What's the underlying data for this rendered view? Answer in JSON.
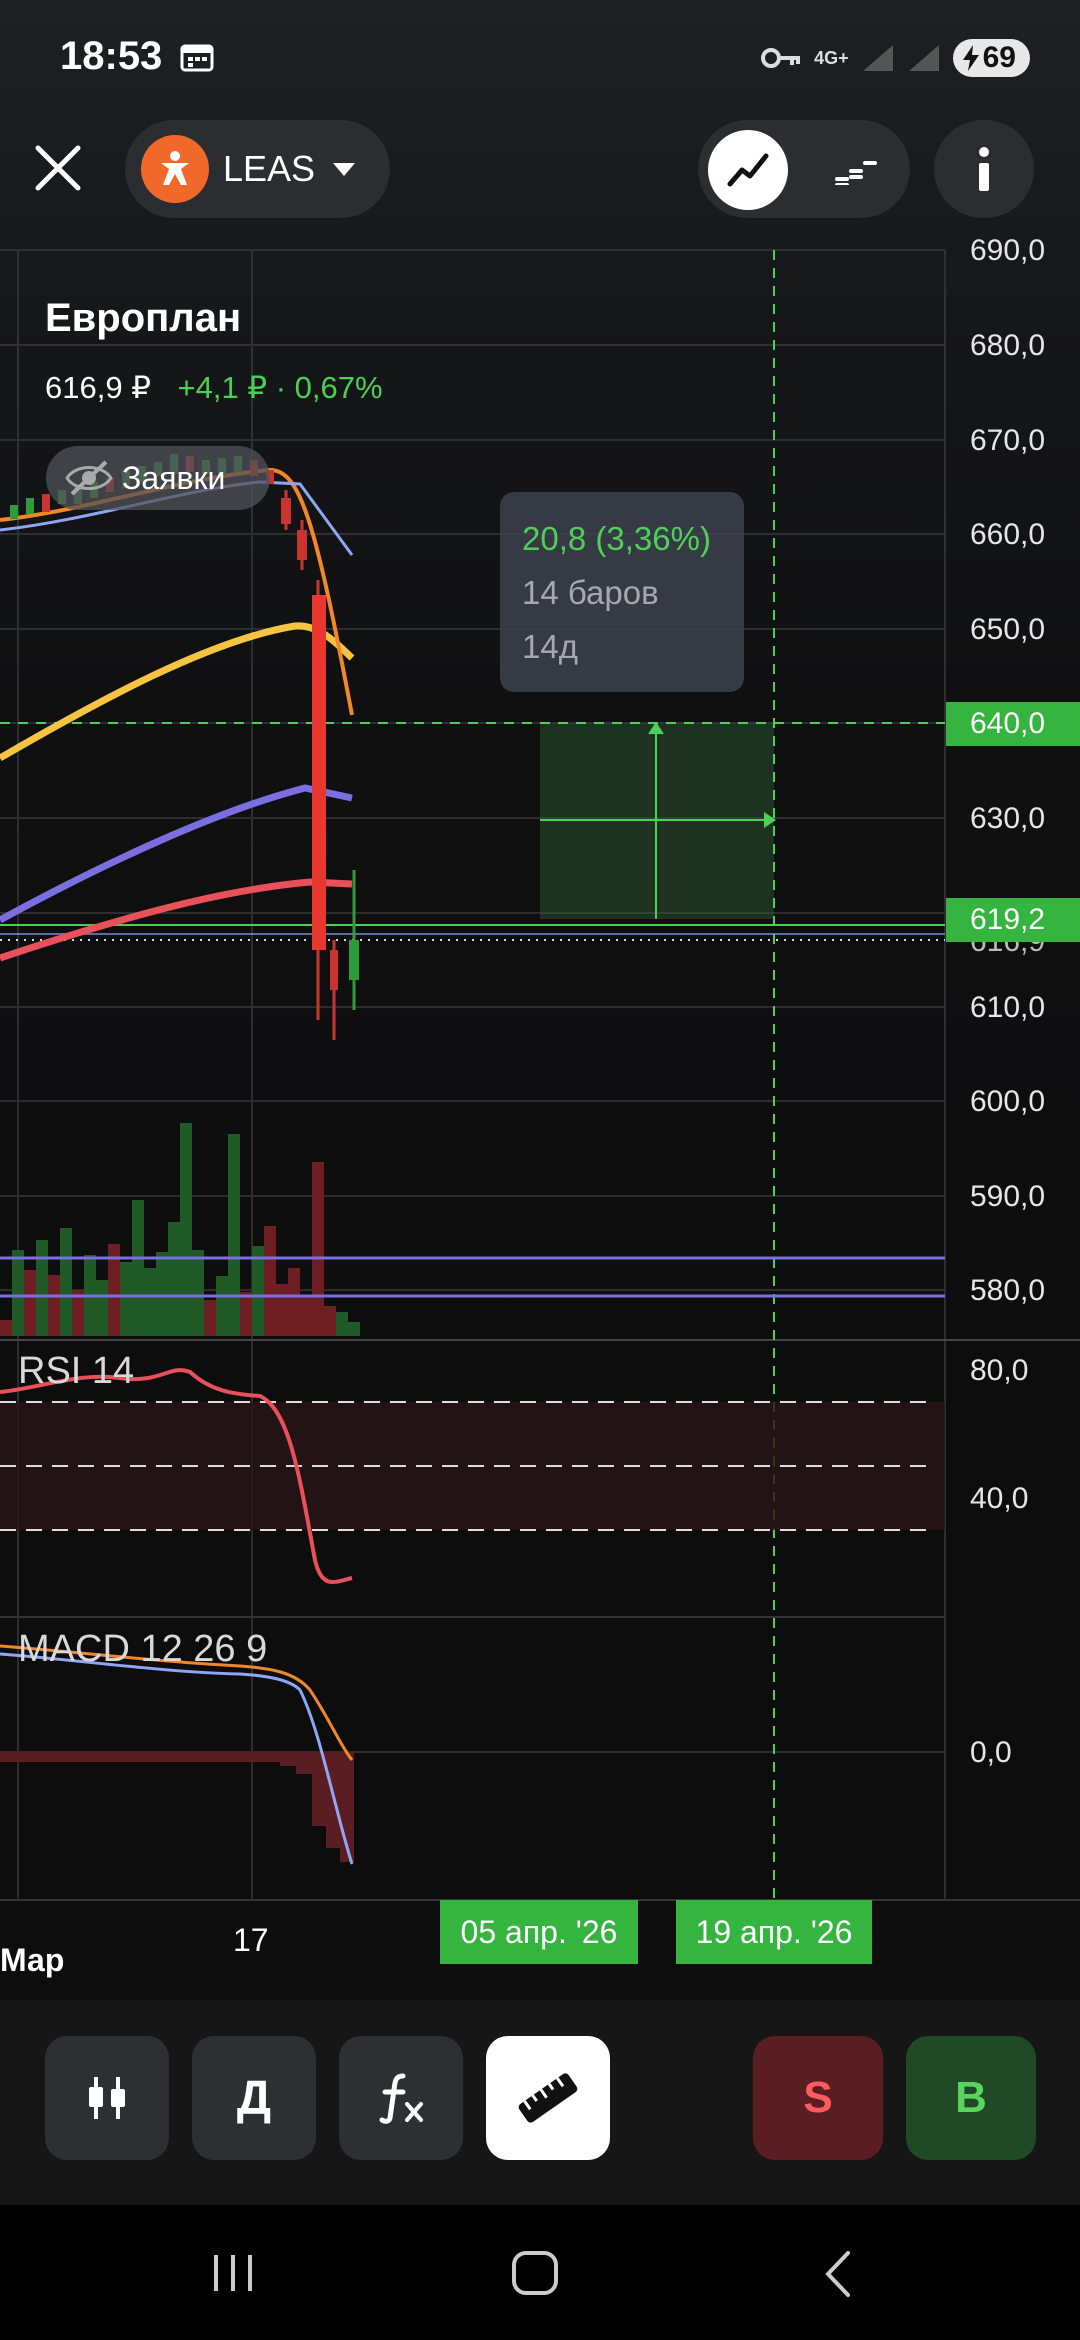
{
  "status_bar": {
    "time": "18:53",
    "network": "4G+",
    "battery": "69"
  },
  "header": {
    "ticker": "LEAS"
  },
  "instrument": {
    "name": "Европлан",
    "price": "616,9 ₽",
    "change": "+4,1 ₽ · 0,67%"
  },
  "orders_toggle_label": "Заявки",
  "measure": {
    "delta": "20,8 (3,36%)",
    "bars": "14 баров",
    "days": "14д"
  },
  "price_axis": [
    "690,0",
    "680,0",
    "670,0",
    "660,0",
    "650,0",
    "640,0",
    "630,0",
    "619,2",
    "616,9",
    "610,0",
    "600,0",
    "590,0",
    "580,0"
  ],
  "badges": {
    "target_price": "640,0",
    "current_price": "619,2"
  },
  "rsi": {
    "label": "RSI 14",
    "axis": [
      "80,0",
      "40,0"
    ]
  },
  "macd": {
    "label": "MACD 12 26 9",
    "axis": [
      "0,0"
    ]
  },
  "date_axis": {
    "left": "Мар",
    "tick": "17",
    "start_badge": "05 апр. '26",
    "end_badge": "19 апр. '26"
  },
  "toolbar": {
    "period": "Д",
    "sell": "S",
    "buy": "B"
  },
  "colors": {
    "accent_green": "#35b43f",
    "sell_red": "#ff5a5f",
    "buy_green": "#5ad45f",
    "ema_yellow": "#f5c542",
    "ema_orange": "#f0882a",
    "ema_purple": "#7a6fe0",
    "ema_red": "#e8505a",
    "bb_blue": "#8fa6f5"
  },
  "icons": [
    "calendar-icon",
    "key-icon",
    "signal-icon",
    "battery-icon",
    "close-icon",
    "ticker-logo-icon",
    "caret-down-icon",
    "line-chart-icon",
    "step-chart-icon",
    "info-icon",
    "eye-off-icon",
    "candles-icon",
    "function-icon",
    "ruler-icon",
    "recents-icon",
    "home-icon",
    "back-icon"
  ]
}
